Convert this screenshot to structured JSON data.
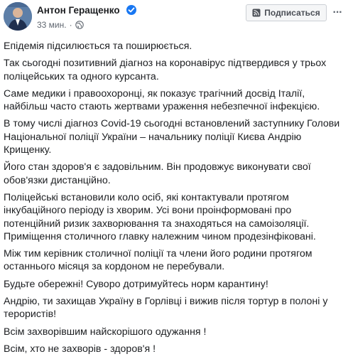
{
  "post": {
    "author": "Антон Геращенко",
    "timestamp": "33 мин.",
    "subscribe_label": "Подписаться",
    "more_label": "···",
    "icons": {
      "verified": "verified-badge-icon",
      "privacy": "globe-icon",
      "subscribe": "rss-icon"
    },
    "paragraphs": [
      "Епідемія підсилюється та поширюється.",
      "Так сьогодні позитивний діагноз на коронавірус підтвердився у трьох поліцейських та одного курсанта.",
      "Саме медики і правоохоронці, як показує трагічний досвід Італії, найбільш часто стають жертвами ураження небезпечної інфекцією.",
      "В тому числі діагноз Covid-19 сьогодні встановлений заступнику Голови Національної поліції України – начальнику поліції Києва Андрію Крищенку.",
      "Його стан здоров'я є задовільним. Він продовжує виконувати свої обов'язки дистанційно.",
      "Поліцейські встановили коло осіб, які контактували протягом інкубаційного періоду із хворим. Усі вони проінформовані про потенційний ризик захворювання та знаходяться на самоізоляції. Приміщення столичного главку належним чином продезінфіковані.",
      "Між тим керівник столичної поліції та члени його родини протягом останнього місяця за кордоном не перебували.",
      "Будьте обережні! Суворо дотримуйтесь норм карантину!",
      "Андрію, ти захищав Україну в Горлівці і вижив після тортур в полоні у терористів!",
      "Всім захворівшим найскорішого одужання !",
      "Всім, хто не захворів - здоров'я !"
    ]
  }
}
